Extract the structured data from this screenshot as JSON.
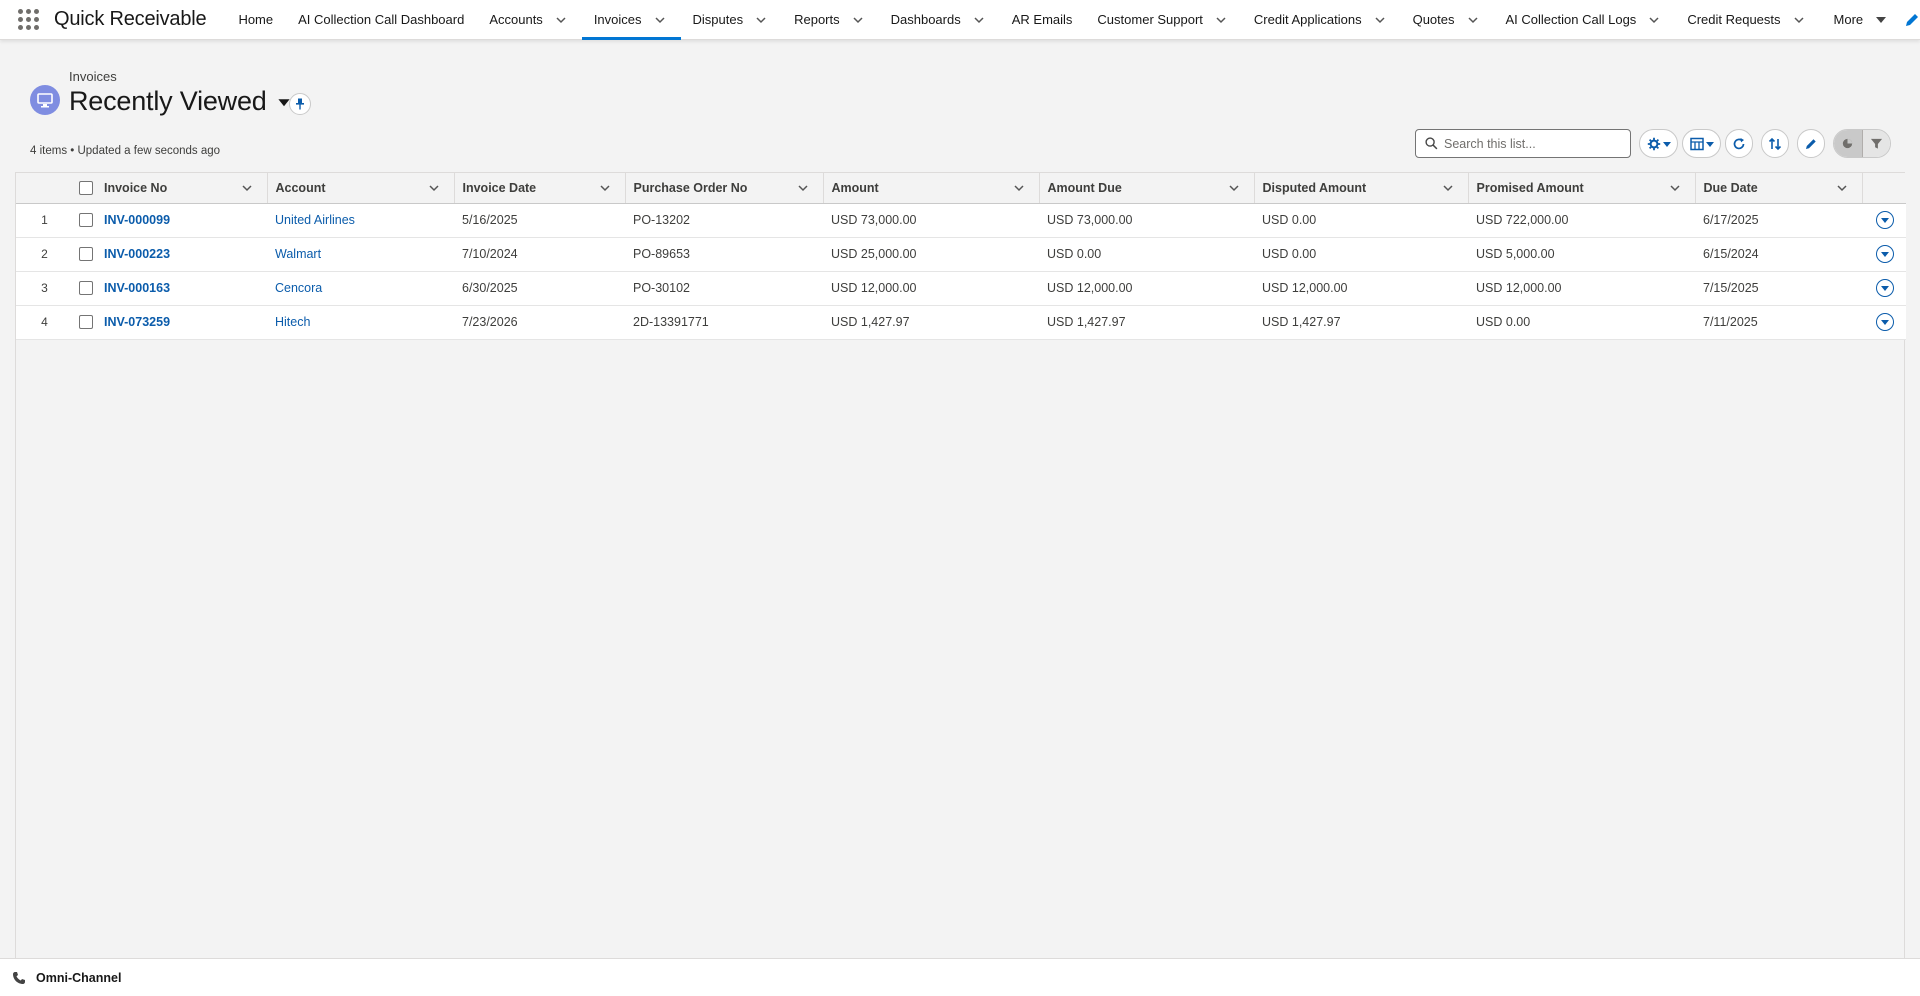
{
  "app": {
    "name": "Quick Receivable"
  },
  "nav": {
    "items": [
      {
        "label": "Home",
        "dropdown": false,
        "active": false
      },
      {
        "label": "AI Collection Call Dashboard",
        "dropdown": false,
        "active": false
      },
      {
        "label": "Accounts",
        "dropdown": true,
        "active": false
      },
      {
        "label": "Invoices",
        "dropdown": true,
        "active": true
      },
      {
        "label": "Disputes",
        "dropdown": true,
        "active": false
      },
      {
        "label": "Reports",
        "dropdown": true,
        "active": false
      },
      {
        "label": "Dashboards",
        "dropdown": true,
        "active": false
      },
      {
        "label": "AR Emails",
        "dropdown": false,
        "active": false
      },
      {
        "label": "Customer Support",
        "dropdown": true,
        "active": false
      },
      {
        "label": "Credit Applications",
        "dropdown": true,
        "active": false
      },
      {
        "label": "Quotes",
        "dropdown": true,
        "active": false
      },
      {
        "label": "AI Collection Call Logs",
        "dropdown": true,
        "active": false
      },
      {
        "label": "Credit Requests",
        "dropdown": true,
        "active": false
      }
    ],
    "more_label": "More"
  },
  "list": {
    "breadcrumb": "Invoices",
    "title": "Recently Viewed",
    "meta": "4 items • Updated a few seconds ago",
    "search_placeholder": "Search this list..."
  },
  "table": {
    "columns": [
      "Invoice No",
      "Account",
      "Invoice Date",
      "Purchase Order No",
      "Amount",
      "Amount Due",
      "Disputed Amount",
      "Promised Amount",
      "Due Date"
    ],
    "rows": [
      {
        "num": "1",
        "invoice_no": "INV-000099",
        "account": "United Airlines",
        "invoice_date": "5/16/2025",
        "po": "PO-13202",
        "amount": "USD 73,000.00",
        "amount_due": "USD 73,000.00",
        "disputed": "USD 0.00",
        "promised": "USD 722,000.00",
        "due_date": "6/17/2025"
      },
      {
        "num": "2",
        "invoice_no": "INV-000223",
        "account": "Walmart",
        "invoice_date": "7/10/2024",
        "po": "PO-89653",
        "amount": "USD 25,000.00",
        "amount_due": "USD 0.00",
        "disputed": "USD 0.00",
        "promised": "USD 5,000.00",
        "due_date": "6/15/2024"
      },
      {
        "num": "3",
        "invoice_no": "INV-000163",
        "account": "Cencora",
        "invoice_date": "6/30/2025",
        "po": "PO-30102",
        "amount": "USD 12,000.00",
        "amount_due": "USD 12,000.00",
        "disputed": "USD 12,000.00",
        "promised": "USD 12,000.00",
        "due_date": "7/15/2025"
      },
      {
        "num": "4",
        "invoice_no": "INV-073259",
        "account": "Hitech",
        "invoice_date": "7/23/2026",
        "po": "2D-13391771",
        "amount": "USD 1,427.97",
        "amount_due": "USD 1,427.97",
        "disputed": "USD 1,427.97",
        "promised": "USD 0.00",
        "due_date": "7/11/2025"
      }
    ]
  },
  "footer": {
    "label": "Omni-Channel"
  },
  "colors": {
    "accent": "#0176d3",
    "link": "#0b5cab",
    "object_icon": "#7f8de1"
  },
  "icons": {
    "app_launcher": "waffle-icon",
    "object": "invoice-icon",
    "pin": "pin-icon",
    "search": "search-icon",
    "settings": "gear-icon",
    "display_as": "table-icon",
    "refresh": "refresh-icon",
    "sort": "sort-icon",
    "inline_edit": "pencil-icon",
    "charts": "chart-icon",
    "filter": "filter-icon",
    "omni": "phone-icon"
  }
}
